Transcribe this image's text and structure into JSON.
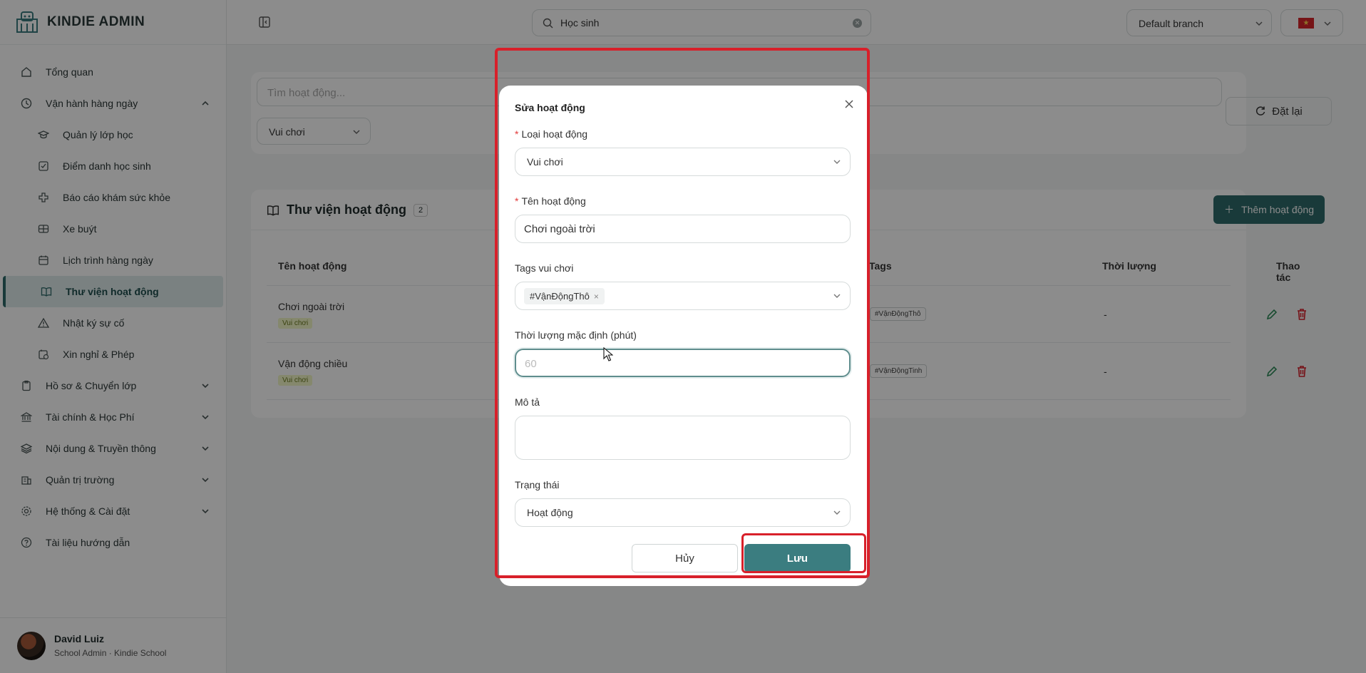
{
  "app": {
    "name": "KINDIE ADMIN"
  },
  "sidebar": {
    "items": [
      {
        "label": "Tổng quan",
        "icon": "home-icon"
      },
      {
        "label": "Vận hành hàng ngày",
        "icon": "clock-icon",
        "expanded": true
      },
      {
        "label": "Hồ sơ & Chuyển lớp",
        "icon": "clipboard-icon"
      },
      {
        "label": "Tài chính & Học Phí",
        "icon": "bank-icon"
      },
      {
        "label": "Nội dung & Truyền thông",
        "icon": "layers-icon"
      },
      {
        "label": "Quản trị trường",
        "icon": "building-icon"
      },
      {
        "label": "Hệ thống & Cài đặt",
        "icon": "gear-icon"
      },
      {
        "label": "Tài liệu hướng dẫn",
        "icon": "help-icon"
      }
    ],
    "subitems": [
      {
        "label": "Quản lý lớp học",
        "icon": "graduation-cap-icon"
      },
      {
        "label": "Điểm danh học sinh",
        "icon": "checkbox-icon"
      },
      {
        "label": "Báo cáo khám sức khỏe",
        "icon": "health-cross-icon"
      },
      {
        "label": "Xe buýt",
        "icon": "bus-icon"
      },
      {
        "label": "Lịch trình hàng ngày",
        "icon": "calendar-icon"
      },
      {
        "label": "Thư viện hoạt động",
        "icon": "book-icon",
        "active": true
      },
      {
        "label": "Nhật ký sự cố",
        "icon": "warning-icon"
      },
      {
        "label": "Xin nghỉ & Phép",
        "icon": "calendar-clock-icon"
      }
    ],
    "user": {
      "name": "David Luiz",
      "role": "School Admin · Kindie School"
    }
  },
  "topbar": {
    "search_value": "Học sinh",
    "branch": "Default branch"
  },
  "filters": {
    "search_placeholder": "Tìm hoạt động...",
    "type_value": "Vui chơi",
    "reset_label": "Đặt lại"
  },
  "library": {
    "title": "Thư viện hoạt động",
    "count": "2",
    "add_label": "Thêm hoạt động",
    "columns": {
      "name": "Tên hoạt động",
      "tags": "Tags",
      "duration": "Thời lượng",
      "actions": "Thao tác"
    },
    "rows": [
      {
        "name": "Chơi ngoài trời",
        "type": "Vui chơi",
        "tag": "#VậnĐộngThô",
        "duration": "-"
      },
      {
        "name": "Vận động chiều",
        "type": "Vui chơi",
        "tag": "#VậnĐộngTinh",
        "duration": "-"
      }
    ]
  },
  "modal": {
    "title": "Sửa hoạt động",
    "type_label": "Loại hoạt động",
    "type_value": "Vui chơi",
    "name_label": "Tên hoạt động",
    "name_value": "Chơi ngoài trời",
    "tags_label": "Tags vui chơi",
    "tag_chip": "#VậnĐộngThô",
    "duration_label": "Thời lượng mặc định (phút)",
    "duration_placeholder": "60",
    "desc_label": "Mô tả",
    "status_label": "Trạng thái",
    "status_value": "Hoạt động",
    "cancel_label": "Hủy",
    "save_label": "Lưu"
  },
  "colors": {
    "accent": "#2f6b6b",
    "save_button": "#3b7d80",
    "highlight": "#d8202a",
    "danger": "#d8202a"
  }
}
